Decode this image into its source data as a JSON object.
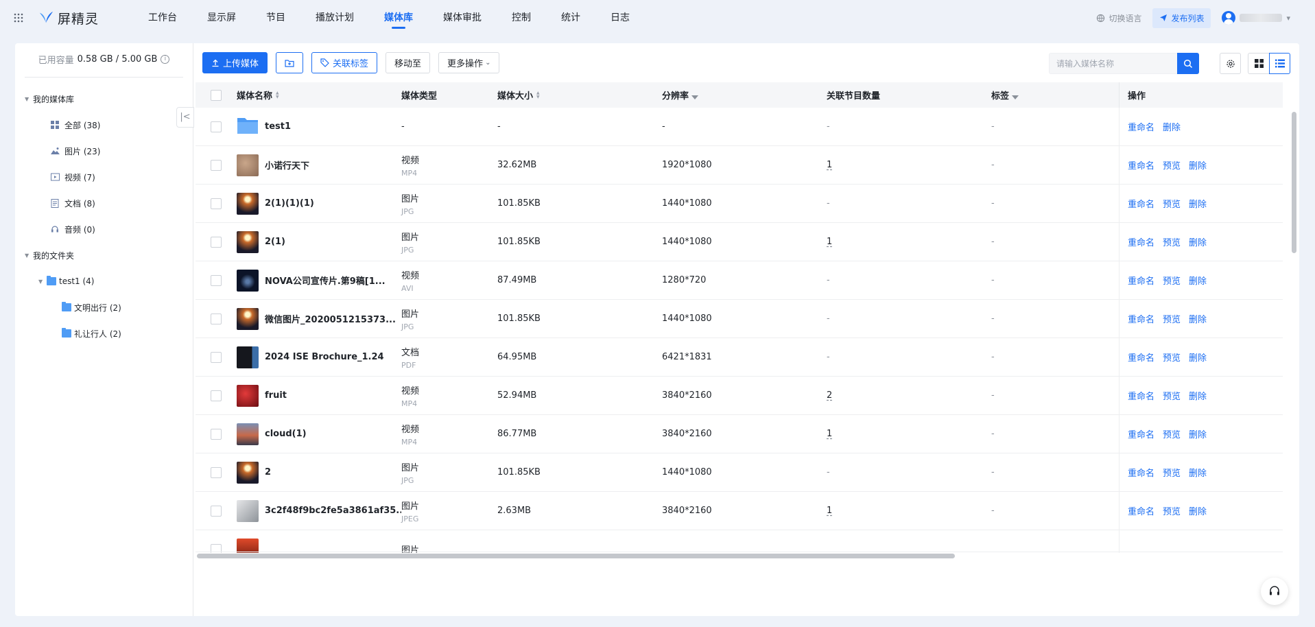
{
  "brand": {
    "name": "屏精灵"
  },
  "nav": [
    {
      "label": "工作台"
    },
    {
      "label": "显示屏"
    },
    {
      "label": "节目"
    },
    {
      "label": "播放计划"
    },
    {
      "label": "媒体库"
    },
    {
      "label": "媒体审批"
    },
    {
      "label": "控制"
    },
    {
      "label": "统计"
    },
    {
      "label": "日志"
    }
  ],
  "nav_active": "媒体库",
  "header": {
    "switch_lang": "切换语言",
    "publish_list": "发布列表"
  },
  "sidebar": {
    "capacity_label": "已用容量",
    "capacity_value": "0.58 GB / 5.00 GB",
    "library_title": "我的媒体库",
    "library_items": [
      {
        "label": "全部 (38)",
        "icon": "grid-icon"
      },
      {
        "label": "图片 (23)",
        "icon": "image-icon"
      },
      {
        "label": "视频 (7)",
        "icon": "video-icon"
      },
      {
        "label": "文档 (8)",
        "icon": "document-icon"
      },
      {
        "label": "音频 (0)",
        "icon": "audio-icon"
      }
    ],
    "folders_title": "我的文件夹",
    "folder_root": "test1 (4)",
    "subfolders": [
      {
        "label": "文明出行 (2)"
      },
      {
        "label": "礼让行人 (2)"
      }
    ]
  },
  "toolbar": {
    "upload": "上传媒体",
    "tag": "关联标签",
    "move_to": "移动至",
    "more": "更多操作"
  },
  "search": {
    "placeholder": "请输入媒体名称"
  },
  "table": {
    "headers": {
      "name": "媒体名称",
      "type": "媒体类型",
      "size": "媒体大小",
      "resolution": "分辨率",
      "related": "关联节目数量",
      "tags": "标签",
      "ops": "操作"
    },
    "op_labels": {
      "rename": "重命名",
      "preview": "预览",
      "delete": "删除"
    },
    "rows": [
      {
        "name": "test1",
        "type": "-",
        "ext": "",
        "size": "-",
        "res": "-",
        "rel": "-",
        "tag": "-",
        "thumb": "folder",
        "preview": false
      },
      {
        "name": "小诺行天下",
        "type": "视频",
        "ext": "MP4",
        "size": "32.62MB",
        "res": "1920*1080",
        "rel": "1",
        "tag": "-",
        "thumb": "sand",
        "preview": true
      },
      {
        "name": "2(1)(1)(1)",
        "type": "图片",
        "ext": "JPG",
        "size": "101.85KB",
        "res": "1440*1080",
        "rel": "-",
        "tag": "-",
        "thumb": "night",
        "preview": true
      },
      {
        "name": "2(1)",
        "type": "图片",
        "ext": "JPG",
        "size": "101.85KB",
        "res": "1440*1080",
        "rel": "1",
        "tag": "-",
        "thumb": "night",
        "preview": true
      },
      {
        "name": "NOVA公司宣传片.第9稿[1...",
        "type": "视频",
        "ext": "AVI",
        "size": "87.49MB",
        "res": "1280*720",
        "rel": "-",
        "tag": "-",
        "thumb": "dark",
        "preview": true
      },
      {
        "name": "微信图片_2020051215373...",
        "type": "图片",
        "ext": "JPG",
        "size": "101.85KB",
        "res": "1440*1080",
        "rel": "-",
        "tag": "-",
        "thumb": "night",
        "preview": true
      },
      {
        "name": "2024 ISE Brochure_1.24",
        "type": "文档",
        "ext": "PDF",
        "size": "64.95MB",
        "res": "6421*1831",
        "rel": "-",
        "tag": "-",
        "thumb": "pdf",
        "preview": true
      },
      {
        "name": "fruit",
        "type": "视频",
        "ext": "MP4",
        "size": "52.94MB",
        "res": "3840*2160",
        "rel": "2",
        "tag": "-",
        "thumb": "fruit",
        "preview": true
      },
      {
        "name": "cloud(1)",
        "type": "视频",
        "ext": "MP4",
        "size": "86.77MB",
        "res": "3840*2160",
        "rel": "1",
        "tag": "-",
        "thumb": "cloud",
        "preview": true
      },
      {
        "name": "2",
        "type": "图片",
        "ext": "JPG",
        "size": "101.85KB",
        "res": "1440*1080",
        "rel": "-",
        "tag": "-",
        "thumb": "night",
        "preview": true
      },
      {
        "name": "3c2f48f9bc2fe5a3861af35...",
        "type": "图片",
        "ext": "JPEG",
        "size": "2.63MB",
        "res": "3840*2160",
        "rel": "1",
        "tag": "-",
        "thumb": "grey",
        "preview": true
      },
      {
        "name": "",
        "type": "图片",
        "ext": "",
        "size": "",
        "res": "",
        "rel": "",
        "tag": "",
        "thumb": "red",
        "preview": false
      }
    ]
  },
  "colors": {
    "accent": "#1c6ef2",
    "background": "#eef2f9",
    "header_row": "#f5f6f8"
  }
}
